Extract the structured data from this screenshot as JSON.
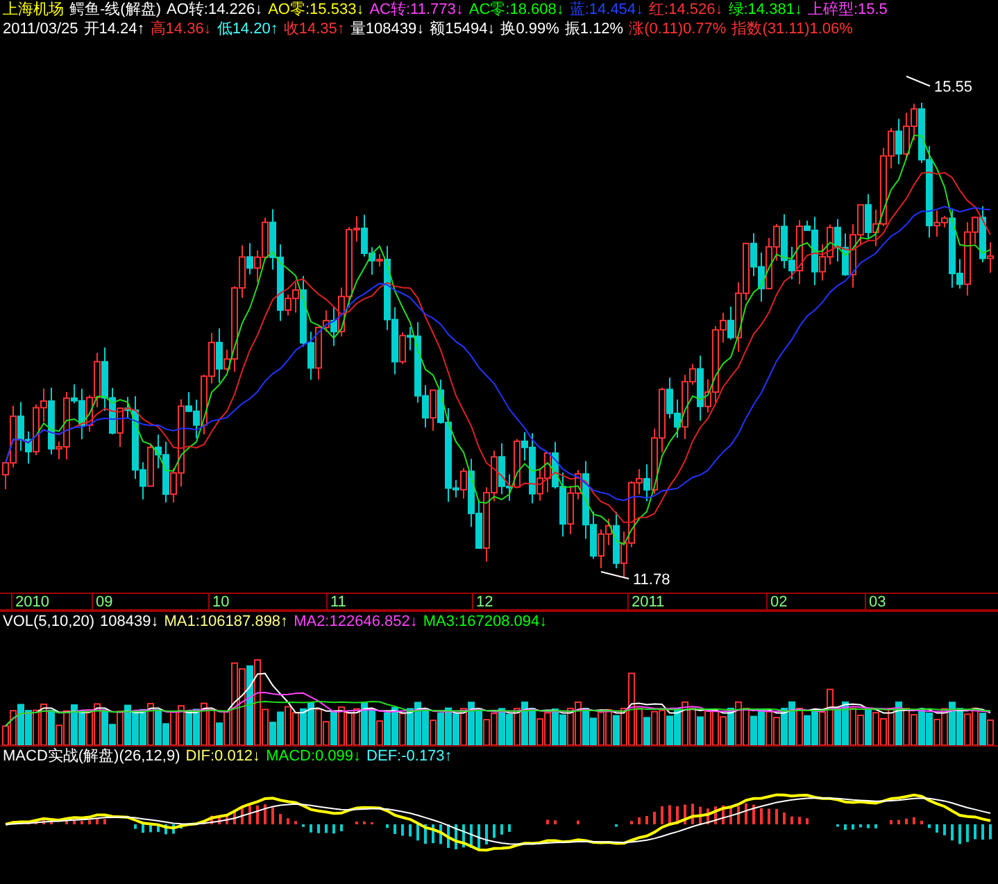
{
  "header": {
    "title": {
      "text": "上海机场",
      "color": "#ffff00"
    },
    "indicator": {
      "text": "鳄鱼-线(解盘)",
      "color": "#ffffff"
    },
    "line_1": [
      {
        "text": "AO转:14.226",
        "arrow": "↓",
        "color": "#ffffff"
      },
      {
        "text": "AO零:15.533",
        "arrow": "↓",
        "color": "#ffff00"
      },
      {
        "text": "AC转:11.773",
        "arrow": "↓",
        "color": "#ff44ff"
      },
      {
        "text": "AC零:18.608",
        "arrow": "↓",
        "color": "#00ff00"
      },
      {
        "text": "蓝:14.454",
        "arrow": "↓",
        "color": "#2244ff"
      },
      {
        "text": "红:14.526",
        "arrow": "↓",
        "color": "#ff3333"
      },
      {
        "text": "绿:14.381",
        "arrow": "↓",
        "color": "#00ff00"
      },
      {
        "text": "上碎型:15.5",
        "color": "#ff44ff"
      }
    ],
    "line_2": [
      {
        "text": "2011/03/25",
        "color": "#ffffff"
      },
      {
        "text": "开14.24",
        "arrow": "↑",
        "color": "#ffffff"
      },
      {
        "text": "高14.36",
        "arrow": "↓",
        "color": "#ff3333"
      },
      {
        "text": "低14.20",
        "arrow": "↑",
        "color": "#44ffff"
      },
      {
        "text": "收14.35",
        "arrow": "↑",
        "color": "#ff3333"
      },
      {
        "text": "量108439",
        "arrow": "↓",
        "color": "#ffffff"
      },
      {
        "text": "额15494",
        "arrow": "↓",
        "color": "#ffffff"
      },
      {
        "text": "换0.99%",
        "color": "#ffffff"
      },
      {
        "text": "振1.12%",
        "color": "#ffffff"
      },
      {
        "text": "涨(0.11)0.77%",
        "color": "#ff3333"
      },
      {
        "text": "指数(31.11)1.06%",
        "color": "#ff3333"
      }
    ]
  },
  "price_labels": {
    "high": "15.55",
    "low": "11.78"
  },
  "time_axis": [
    "2010",
    "09",
    "10",
    "11",
    "12",
    "2011",
    "02",
    "03"
  ],
  "volume_header": [
    {
      "text": "VOL(5,10,20)",
      "color": "#ffffff"
    },
    {
      "text": "108439",
      "arrow": "↓",
      "color": "#ffffff"
    },
    {
      "text": "MA1:106187.898",
      "arrow": "↑",
      "color": "#ffff88"
    },
    {
      "text": "MA2:122646.852",
      "arrow": "↓",
      "color": "#ff44ff"
    },
    {
      "text": "MA3:167208.094",
      "arrow": "↓",
      "color": "#00ff00"
    }
  ],
  "macd_header": [
    {
      "text": "MACD实战(解盘)(26,12,9)",
      "color": "#ffffff"
    },
    {
      "text": "DIF:0.012",
      "arrow": "↓",
      "color": "#ffff66"
    },
    {
      "text": "MACD:0.099",
      "arrow": "↓",
      "color": "#00ff00"
    },
    {
      "text": "DEF:-0.173",
      "arrow": "↑",
      "color": "#44ffff"
    }
  ]
}
